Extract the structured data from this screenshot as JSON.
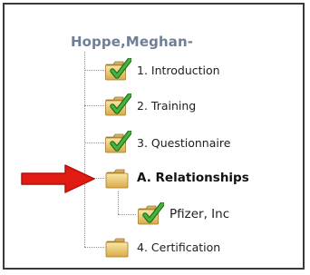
{
  "tree": {
    "root_label": "Hoppe,Meghan-",
    "items": [
      {
        "label": "1. Introduction",
        "icon": "folder-checked-icon",
        "status": "complete"
      },
      {
        "label": "2. Training",
        "icon": "folder-checked-icon",
        "status": "complete"
      },
      {
        "label": "3. Questionnaire",
        "icon": "folder-checked-icon",
        "status": "complete"
      },
      {
        "label": "A. Relationships",
        "icon": "folder-icon",
        "status": "selected",
        "children": [
          {
            "label": "Pfizer, Inc",
            "icon": "folder-checked-icon",
            "status": "complete"
          }
        ]
      },
      {
        "label": "4. Certification",
        "icon": "folder-icon",
        "status": "incomplete"
      }
    ]
  },
  "annotation": {
    "icon": "red-arrow-icon",
    "color": "#e01c12"
  },
  "colors": {
    "root_text": "#6f7f94",
    "check": "#2f9a2a",
    "folder": "#e8c46a"
  }
}
